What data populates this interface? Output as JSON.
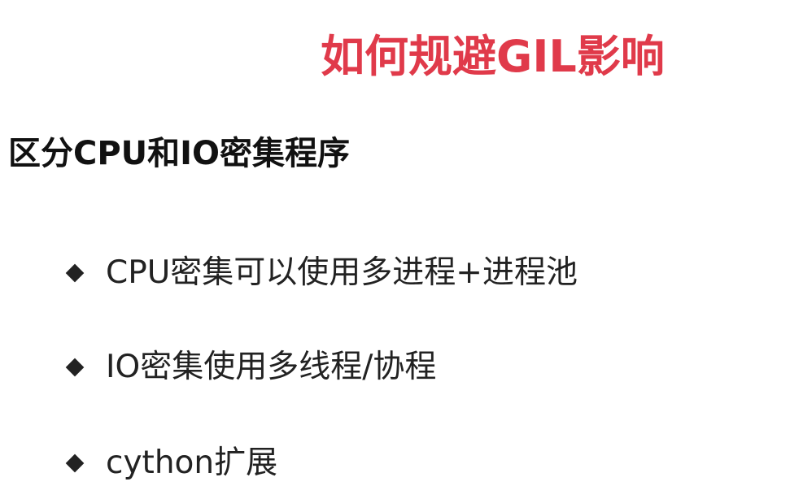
{
  "slide": {
    "title": "如何规避GIL影响",
    "subtitle": "区分CPU和IO密集程序",
    "bullets": [
      {
        "icon": "diamond-bullet-icon",
        "text": "CPU密集可以使用多进程+进程池"
      },
      {
        "icon": "diamond-bullet-icon",
        "text": "IO密集使用多线程/协程"
      },
      {
        "icon": "diamond-bullet-icon",
        "text": "cython扩展"
      }
    ]
  },
  "colors": {
    "title": "#e03a4a",
    "text": "#222222",
    "background": "#ffffff"
  }
}
